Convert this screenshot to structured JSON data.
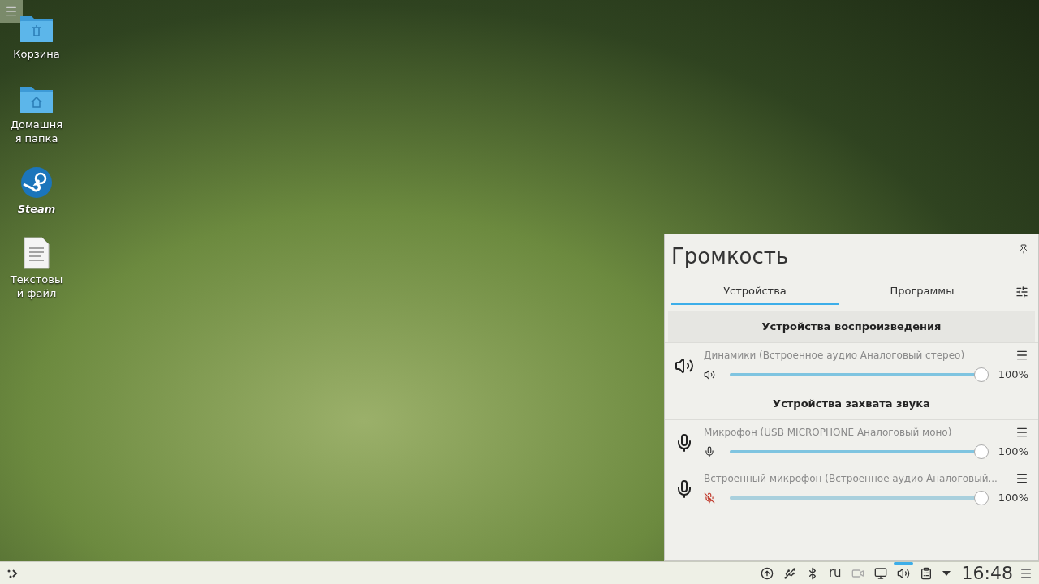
{
  "desktop_icons": [
    {
      "kind": "trash-folder",
      "label": "Корзина",
      "italic": false
    },
    {
      "kind": "home-folder",
      "label": "Домашняя папка",
      "italic": false
    },
    {
      "kind": "steam",
      "label": "Steam",
      "italic": true
    },
    {
      "kind": "text-file",
      "label": "Текстовый файл",
      "italic": false
    }
  ],
  "volume_popup": {
    "title": "Громкость",
    "tabs": [
      {
        "label": "Устройства",
        "selected": true
      },
      {
        "label": "Программы",
        "selected": false
      }
    ],
    "sections": [
      {
        "title": "Устройства воспроизведения",
        "devices": [
          {
            "kind": "speaker",
            "name": "Динамики (Встроенное аудио Аналоговый стерео)",
            "muted": false,
            "level": 1,
            "reading": "100%"
          }
        ]
      },
      {
        "title": "Устройства захвата звука",
        "devices": [
          {
            "kind": "microphone",
            "name": "Микрофон (USB MICROPHONE Аналоговый моно)",
            "muted": false,
            "level": 1,
            "reading": "100%"
          },
          {
            "kind": "microphone",
            "name": "Встроенный микрофон (Встроенное аудио Аналоговый...",
            "muted": true,
            "level": 1,
            "reading": "100%"
          }
        ]
      }
    ]
  },
  "taskbar": {
    "tray": [
      {
        "kind": "updates",
        "active": false
      },
      {
        "kind": "usb",
        "active": false
      },
      {
        "kind": "bluetooth",
        "active": false
      },
      {
        "kind": "keyboard-layout",
        "label": "ru",
        "active": false
      },
      {
        "kind": "camera",
        "active": false
      },
      {
        "kind": "network",
        "active": false
      },
      {
        "kind": "volume",
        "active": true
      },
      {
        "kind": "clipboard",
        "active": false
      },
      {
        "kind": "expand",
        "active": false
      }
    ],
    "clock": "16:48"
  }
}
